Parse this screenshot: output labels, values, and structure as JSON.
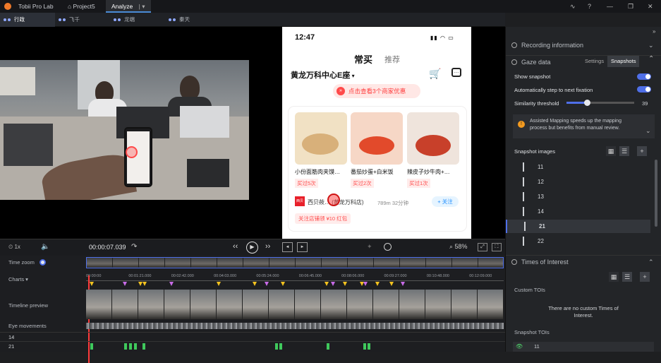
{
  "app": {
    "name": "Tobii Pro Lab",
    "project_tab": "Project5",
    "analyze_tab": "Analyze"
  },
  "participants": [
    {
      "label": "行政",
      "selected": true
    },
    {
      "label": "飞千",
      "selected": false
    },
    {
      "label": "龙端",
      "selected": false
    },
    {
      "label": "秦天",
      "selected": false
    }
  ],
  "phone": {
    "time": "12:47",
    "tab_active": "常买",
    "tab_other": "推荐",
    "location": "黄龙万科中心E座",
    "coupon_banner": "点击查看3个商家优惠",
    "items": [
      {
        "name": "小份面筋肉夹馍…",
        "tag": "买过5次",
        "color1": "#d8b07a",
        "color2": "#f1e1c4"
      },
      {
        "name": "番茄炒蛋+白米饭",
        "tag": "买过2次",
        "color1": "#e24a2b",
        "color2": "#f6d7c6"
      },
      {
        "name": "辣皮子炒牛肉+…",
        "tag": "买过1次",
        "color1": "#c8402a",
        "color2": "#efe4dc"
      }
    ],
    "shop": {
      "logo": "西贝",
      "name": "西贝莜… (黄龙万科店)",
      "distance": "789m 32分钟",
      "follow": "+ 关注",
      "promo": "关注店铺领 ¥10 红包"
    }
  },
  "right_panel": {
    "recording_info": "Recording information",
    "gaze_data": "Gaze data",
    "settings_tab": "Settings",
    "snapshots_tab": "Snapshots",
    "show_snapshot": "Show snapshot",
    "auto_step": "Automatically step to next fixation",
    "similarity": "Similarity threshold",
    "similarity_value": "39",
    "similarity_fraction": 0.3,
    "info_text": "Assisted Mapping speeds up the mapping process but benefits from manual review.",
    "snapshot_images": "Snapshot images",
    "snapshot_numbers": [
      "11",
      "12",
      "13",
      "14",
      "21",
      "22"
    ],
    "selected_snapshot": "21",
    "toi_title": "Times of Interest",
    "custom_tois": "Custom TOIs",
    "no_tois": "There are no custom Times of Interest.",
    "snapshot_tois": "Snapshot TOIs",
    "snapshot_toi_first": "11"
  },
  "controls": {
    "speed": "1x",
    "timecode": "00:00:07.039",
    "zoom": "58%"
  },
  "timeline": {
    "labels": [
      "Time zoom",
      "Charts",
      "Timeline preview",
      "Eye movements",
      "14",
      "21"
    ],
    "ticks": [
      "00:00:00",
      "00:01:21.000",
      "00:02:42.000",
      "00:04:03.000",
      "00:05:24.000",
      "00:06:45.000",
      "00:08:06.000",
      "00:09:27.000",
      "00:10:48.000",
      "00:12:09.000"
    ]
  },
  "colors": {
    "accent": "#4f6fe8",
    "orange": "#f39a1f",
    "phone_red": "#ff4a4a"
  }
}
